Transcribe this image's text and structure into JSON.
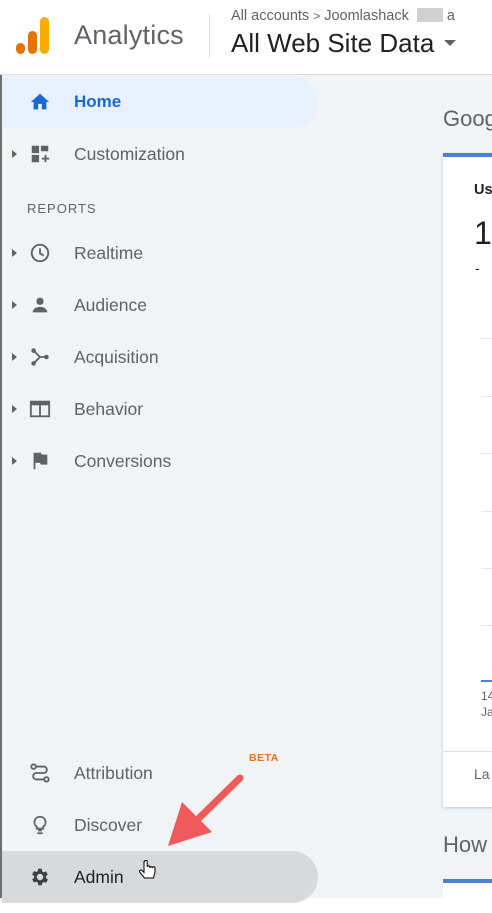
{
  "header": {
    "brand": "Analytics",
    "breadcrumb_root": "All accounts",
    "breadcrumb_separator": ">",
    "breadcrumb_account": "Joomlashack",
    "breadcrumb_tail": "a",
    "view_name": "All Web Site Data"
  },
  "sidebar": {
    "items_top": [
      {
        "label": "Home",
        "icon": "home-icon",
        "active": true
      },
      {
        "label": "Customization",
        "icon": "dashboard-icon",
        "expandable": true
      }
    ],
    "section_label": "REPORTS",
    "reports": [
      {
        "label": "Realtime",
        "icon": "clock-icon"
      },
      {
        "label": "Audience",
        "icon": "person-icon"
      },
      {
        "label": "Acquisition",
        "icon": "acquisition-icon"
      },
      {
        "label": "Behavior",
        "icon": "behavior-icon"
      },
      {
        "label": "Conversions",
        "icon": "flag-icon"
      }
    ],
    "items_bottom": [
      {
        "label": "Attribution",
        "icon": "attribution-icon",
        "badge": "BETA"
      },
      {
        "label": "Discover",
        "icon": "lightbulb-icon"
      },
      {
        "label": "Admin",
        "icon": "gear-icon",
        "hovered": true
      }
    ]
  },
  "main": {
    "title": "Goog",
    "card_metric": "Us",
    "card_value": "1",
    "card_delta": "-",
    "x_tick_1": "14",
    "x_tick_2": "Ja",
    "card_footer": "La",
    "title2": "How"
  },
  "colors": {
    "accent": "#1967d2",
    "active_bg": "#e8f0fe",
    "sidebar_bg": "#f1f3f4",
    "beta": "#e8711a",
    "annotation_arrow": "#f05a5a",
    "card_top": "#4a80d9"
  }
}
